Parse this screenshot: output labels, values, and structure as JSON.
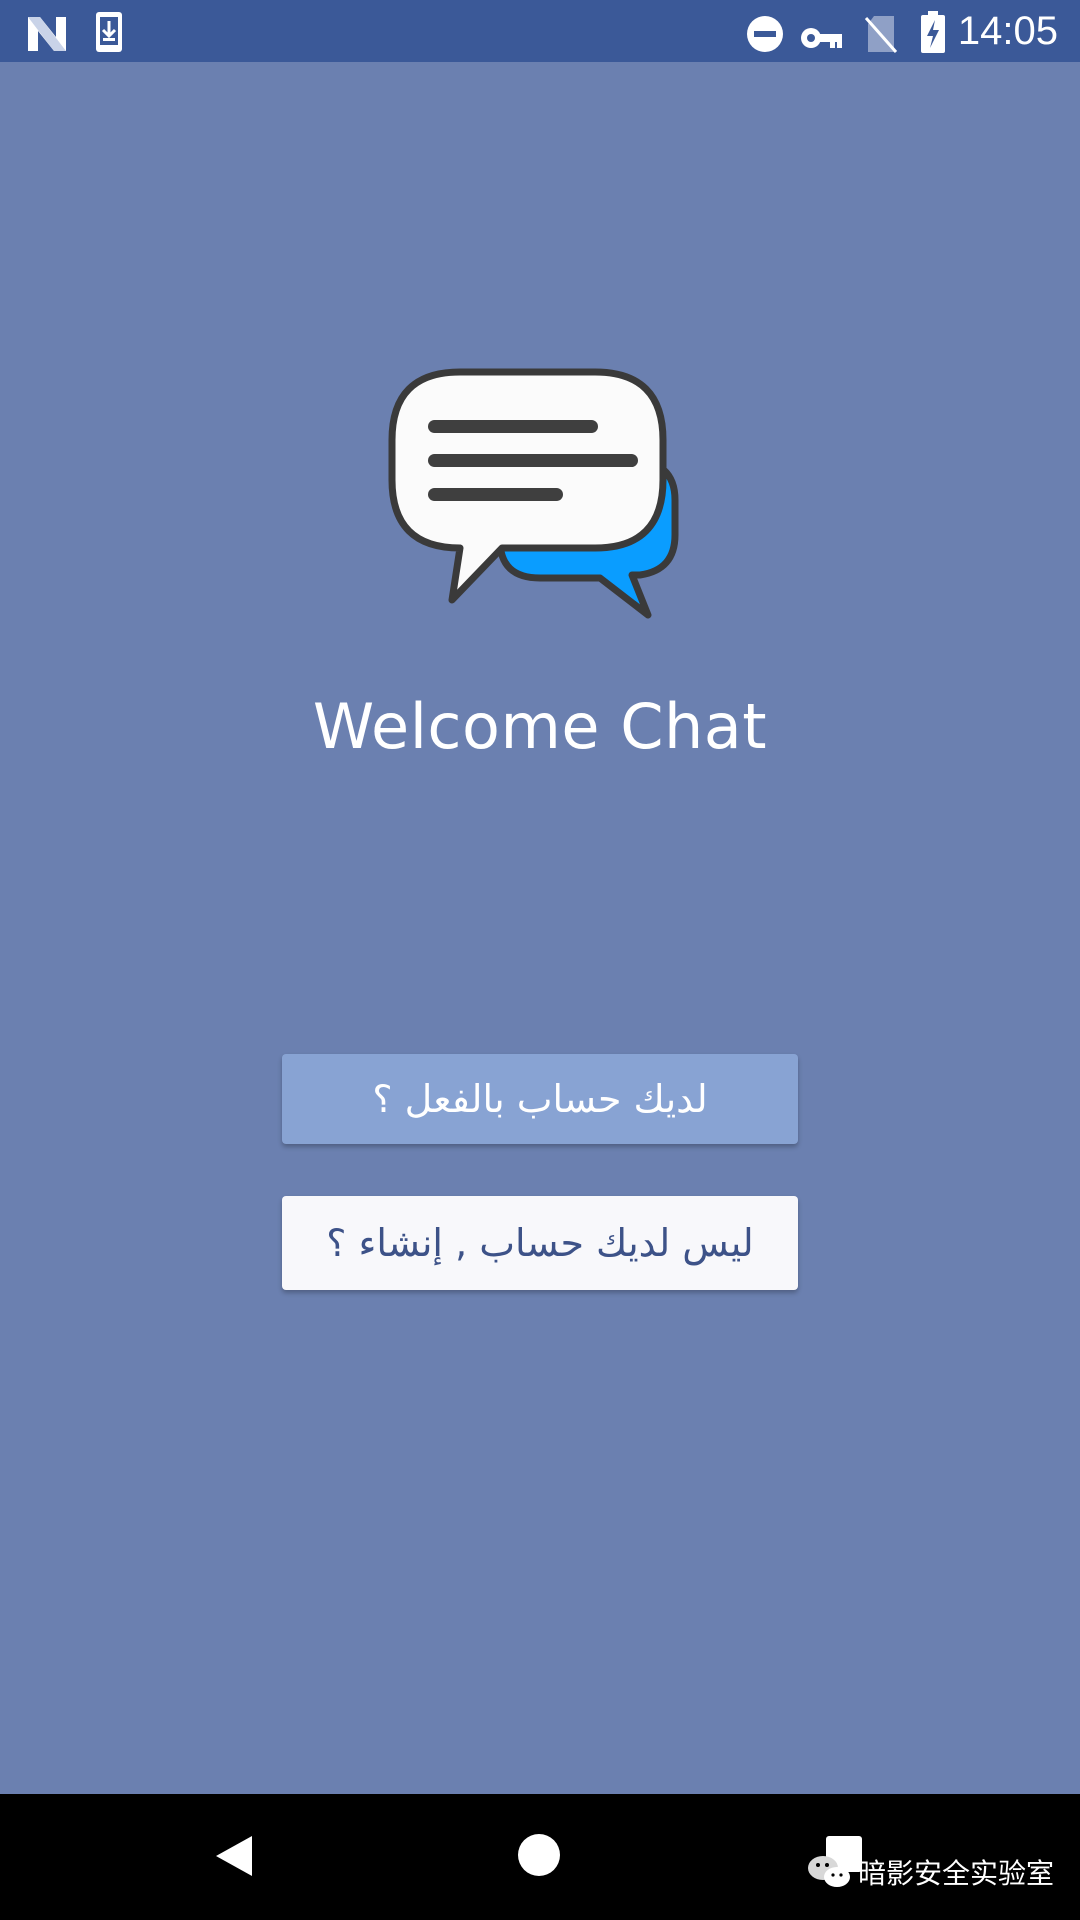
{
  "status_bar": {
    "time": "14:05",
    "left_icons": [
      "n-notification-icon",
      "download-icon"
    ],
    "right_icons": [
      "do-not-disturb-icon",
      "vpn-key-icon",
      "no-sim-icon",
      "battery-charging-icon"
    ]
  },
  "app": {
    "logo_icon": "chat-bubbles-icon",
    "title": "Welcome Chat",
    "colors": {
      "background": "#6b80b0",
      "status_bar": "#3b5998",
      "primary_button": "#88a3d3",
      "secondary_button": "#f8f8fb",
      "secondary_button_text": "#3d5288",
      "bubble_accent": "#0a9dff"
    }
  },
  "buttons": {
    "login_label": "لديك حساب بالفعل ؟",
    "register_label": "ليس لديك حساب , إنشاء ؟"
  },
  "nav_bar": {
    "back_icon": "back-triangle-icon",
    "home_icon": "home-circle-icon",
    "recent_icon": "recent-apps-icon"
  },
  "watermark": {
    "text": "暗影安全实验室"
  }
}
